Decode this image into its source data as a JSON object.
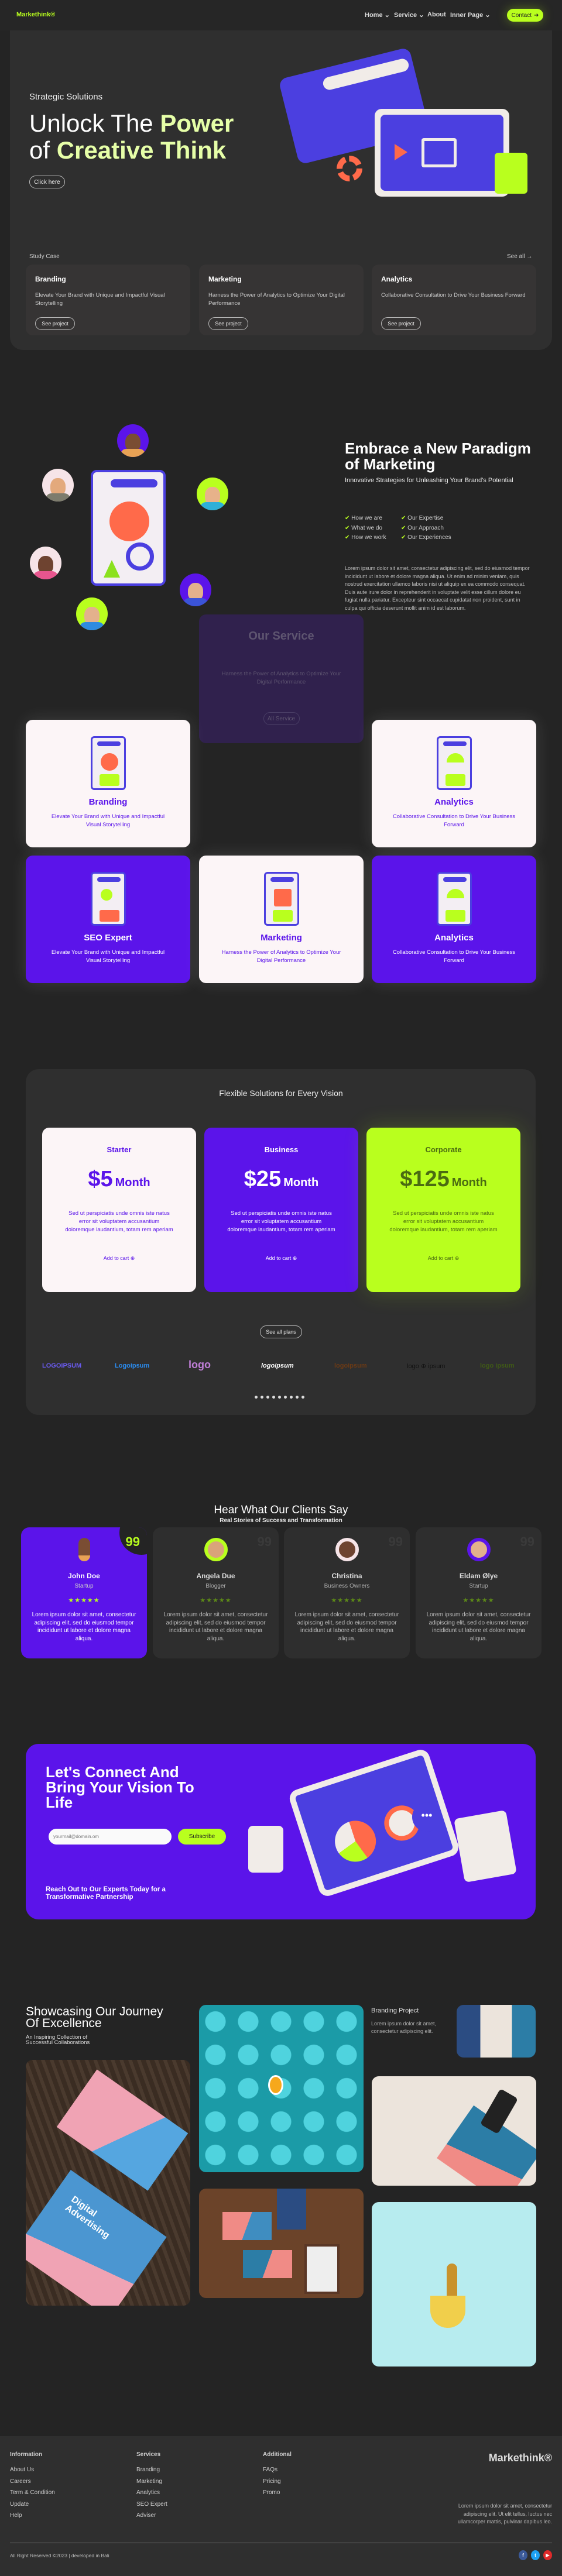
{
  "header": {
    "logo": "Markethink®",
    "nav": [
      {
        "label": "Home",
        "caret": true
      },
      {
        "label": "Service",
        "caret": true
      },
      {
        "label": "About",
        "caret": false
      },
      {
        "label": "Inner Page",
        "caret": true
      }
    ],
    "contact": "Contact"
  },
  "hero": {
    "eyebrow": "Strategic Solutions",
    "title_1": "Unlock The ",
    "title_1_accent": "Power",
    "title_2": "of ",
    "title_2_accent": "Creative Think",
    "cta": "Click here",
    "study_label": "Study Case",
    "see_all": "See all →",
    "cases": [
      {
        "title": "Branding",
        "desc": "Elevate Your Brand with Unique and Impactful Visual Storytelling",
        "btn": "See project"
      },
      {
        "title": "Marketing",
        "desc": "Harness the Power of Analytics to Optimize Your Digital Performance",
        "btn": "See project"
      },
      {
        "title": "Analytics",
        "desc": "Collaborative Consultation to Drive Your Business Forward",
        "btn": "See project"
      }
    ]
  },
  "about": {
    "title": "Embrace a New Paradigm of Marketing",
    "subtitle": "Innovative Strategies for Unleashing Your Brand's Potential",
    "checks": [
      "How we are",
      "What we do",
      "How we work",
      "Our Expertise",
      "Our Approach",
      "Our Experiences"
    ],
    "paragraph": "Lorem ipsum dolor sit amet, consectetur adipiscing elit, sed do eiusmod tempor incididunt ut labore et dolore magna aliqua. Ut enim ad minim veniam, quis nostrud exercitation ullamco laboris nisi ut aliquip ex ea commodo consequat. Duis aute irure dolor in reprehenderit in voluptate velit esse cillum dolore eu fugiat nulla pariatur. Excepteur sint occaecat cupidatat non proident, sunt in culpa qui officia deserunt mollit anim id est laborum."
  },
  "services": {
    "title": "Our Service",
    "desc": "Harness the Power of Analytics to Optimize Your Digital Performance",
    "btn": "All Service",
    "cards": [
      {
        "title": "Branding",
        "desc": "Elevate Your Brand with Unique and Impactful Visual Storytelling"
      },
      {
        "title": "Analytics",
        "desc": "Collaborative Consultation to Drive Your Business Forward"
      },
      {
        "title": "SEO Expert",
        "desc": "Elevate Your Brand with Unique and Impactful Visual Storytelling"
      },
      {
        "title": "Marketing",
        "desc": "Harness the Power of Analytics to Optimize Your Digital Performance"
      },
      {
        "title": "Analytics",
        "desc": "Collaborative Consultation to Drive Your Business Forward"
      }
    ]
  },
  "pricing": {
    "title": "Flexible Solutions for Every Vision",
    "plans": [
      {
        "name": "Starter",
        "price": "$5",
        "period": "Month",
        "desc": "Sed ut perspiciatis unde omnis iste natus error sit voluptatem accusantium doloremque laudantium, totam rem aperiam",
        "cta": "Add to cart"
      },
      {
        "name": "Business",
        "price": "$25",
        "period": "Month",
        "desc": "Sed ut perspiciatis unde omnis iste natus error sit voluptatem accusantium doloremque laudantium, totam rem aperiam",
        "cta": "Add to cart"
      },
      {
        "name": "Corporate",
        "price": "$125",
        "period": "Month",
        "desc": "Sed ut perspiciatis unde omnis iste natus error sit voluptatem accusantium doloremque laudantium, totam rem aperiam",
        "cta": "Add to cart"
      }
    ],
    "see_all": "See all plans",
    "logos": [
      "LOGOIPSUM",
      "Logoipsum",
      "logo",
      "logoipsum",
      "logoipsum",
      "logo ⊕ ipsum",
      "logo ipsum"
    ],
    "dots": 9
  },
  "testimonials": {
    "title": "Hear What Our Clients Say",
    "subtitle": "Real Stories of Success and Transformation",
    "items": [
      {
        "name": "John Doe",
        "role": "Startup",
        "text": "Lorem ipsum dolor sit amet, consectetur adipiscing elit, sed do eiusmod tempor incididunt ut labore et dolore magna aliqua.",
        "rating": 5
      },
      {
        "name": "Angela Due",
        "role": "Blogger",
        "text": "Lorem ipsum dolor sit amet, consectetur adipiscing elit, sed do eiusmod tempor incididunt ut labore et dolore magna aliqua.",
        "rating": 5
      },
      {
        "name": "Christina",
        "role": "Business Owners",
        "text": "Lorem ipsum dolor sit amet, consectetur adipiscing elit, sed do eiusmod tempor incididunt ut labore et dolore magna aliqua.",
        "rating": 5
      },
      {
        "name": "Eldam Ølye",
        "role": "Startup",
        "text": "Lorem ipsum dolor sit amet, consectetur adipiscing elit, sed do eiusmod tempor incididunt ut labore et dolore magna aliqua.",
        "rating": 5
      }
    ],
    "stars": "★★★★★",
    "quote": "99"
  },
  "connect": {
    "title": "Let's Connect And Bring Your Vision To Life",
    "placeholder": "yourmail@domain.om",
    "subscribe": "Subscribe",
    "tagline": "Reach Out to Our Experts Today for a Transformative Partnership"
  },
  "showcase": {
    "title": "Showcasing Our Journey Of Excellence",
    "subtitle": "An Inspiring Collection of Successful Collaborations",
    "project_title": "Branding Project",
    "project_desc": "Lorem ipsum dolor sit amet, consectetur adipiscing elit.",
    "card_text": "Digital Advertising"
  },
  "footer": {
    "columns": [
      {
        "title": "Information",
        "links": [
          "About Us",
          "Careers",
          "Term & Condition",
          "Update",
          "Help"
        ]
      },
      {
        "title": "Services",
        "links": [
          "Branding",
          "Marketing",
          "Analytics",
          "SEO Expert",
          "Adviser"
        ]
      },
      {
        "title": "Additional",
        "links": [
          "FAQs",
          "Pricing",
          "Promo"
        ]
      }
    ],
    "brand": "Markethink®",
    "about": "Lorem ipsum dolor sit amet, consectetur adipiscing elit. Ut elit tellus, luctus nec ullamcorper mattis, pulvinar dapibus leo.",
    "copyright": "All Right Reserved ©2023 | developed in Bali",
    "social": [
      {
        "icon": "facebook-icon",
        "glyph": "f",
        "color": "#3b5998"
      },
      {
        "icon": "twitter-icon",
        "glyph": "t",
        "color": "#1da1f2"
      },
      {
        "icon": "youtube-icon",
        "glyph": "▶",
        "color": "#e02a2a"
      }
    ]
  },
  "colors": {
    "bg": "#242424",
    "panel": "#2f2f2f",
    "purple": "#5b14ea",
    "lime": "#b9ff1e",
    "cream": "#fcf5f7"
  }
}
